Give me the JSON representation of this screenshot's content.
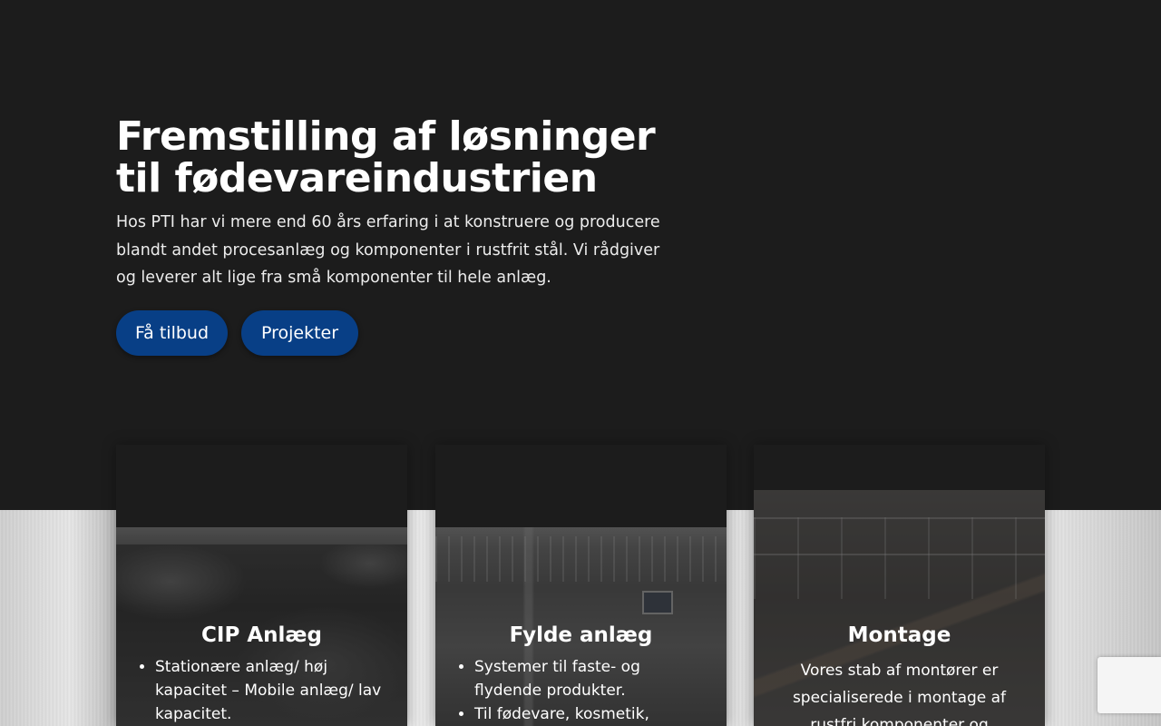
{
  "hero": {
    "title_line1": "Fremstilling af løsninger",
    "title_line2": "til fødevareindustrien",
    "description": "Hos PTI har vi mere end 60 års erfaring i at konstruere og producere blandt andet procesanlæg og komponenter i rustfrit stål. Vi rådgiver og leverer alt lige fra små komponenter til hele anlæg.",
    "buttons": {
      "offer_label": "Få tilbud",
      "projects_label": "Projekter"
    }
  },
  "cards": [
    {
      "title": "CIP Anlæg",
      "items": [
        "Stationære anlæg/ høj kapacitet – Mobile anlæg/ lav kapacitet."
      ]
    },
    {
      "title": "Fylde anlæg",
      "items": [
        "Systemer til faste- og flydende produkter.",
        "Til fødevare, kosmetik,"
      ]
    },
    {
      "title": "Montage",
      "text": "Vores stab af montører er specialiserede i montage af rustfri komponenter og"
    }
  ],
  "colors": {
    "background": "#1c1c1c",
    "button": "#083f86",
    "text": "#ffffff"
  }
}
